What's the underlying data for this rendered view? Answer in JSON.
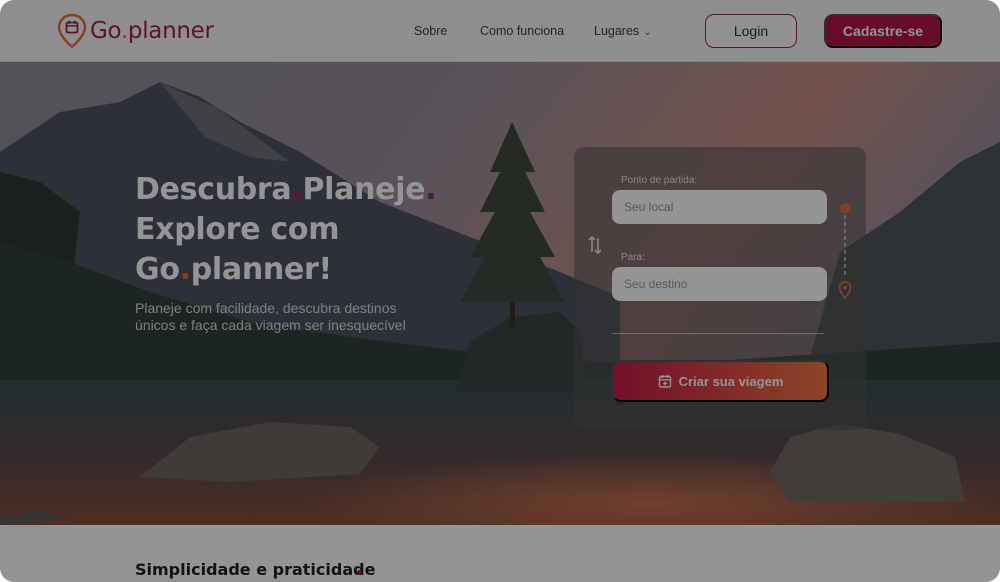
{
  "brand": {
    "name_prefix": "Go",
    "name_dot": ".",
    "name_suffix": "planner",
    "color_primary": "#b0144a",
    "color_accent": "#ea6b3c"
  },
  "nav": {
    "items": [
      {
        "label": "Sobre"
      },
      {
        "label": "Como funciona"
      },
      {
        "label": "Lugares"
      }
    ]
  },
  "header": {
    "login_label": "Login",
    "signup_label": "Cadastre-se"
  },
  "hero": {
    "line1_a": "Descubra",
    "line1_dot": ".",
    "line1_b": "Planeje",
    "line1_dot2": ".",
    "line2": "Explore com",
    "line3_a": "Go",
    "line3_dot": ".",
    "line3_b": "planner!",
    "subtitle": "Planeje com facilidade, descubra destinos únicos e faça cada viagem ser inesquecível"
  },
  "form": {
    "origin_label": "Ponto de partida:",
    "origin_placeholder": "Seu local",
    "destination_label": "Para:",
    "destination_placeholder": "Seu destino",
    "create_button_label": "Criar sua viagem"
  },
  "section": {
    "title": "Simplicidade e praticidade"
  },
  "icons": {
    "logo": "map-pin-calendar-icon",
    "nav_dropdown": "chevron-down-icon",
    "swap": "swap-arrows-icon",
    "route": "route-pin-icon",
    "create": "calendar-plus-icon"
  }
}
